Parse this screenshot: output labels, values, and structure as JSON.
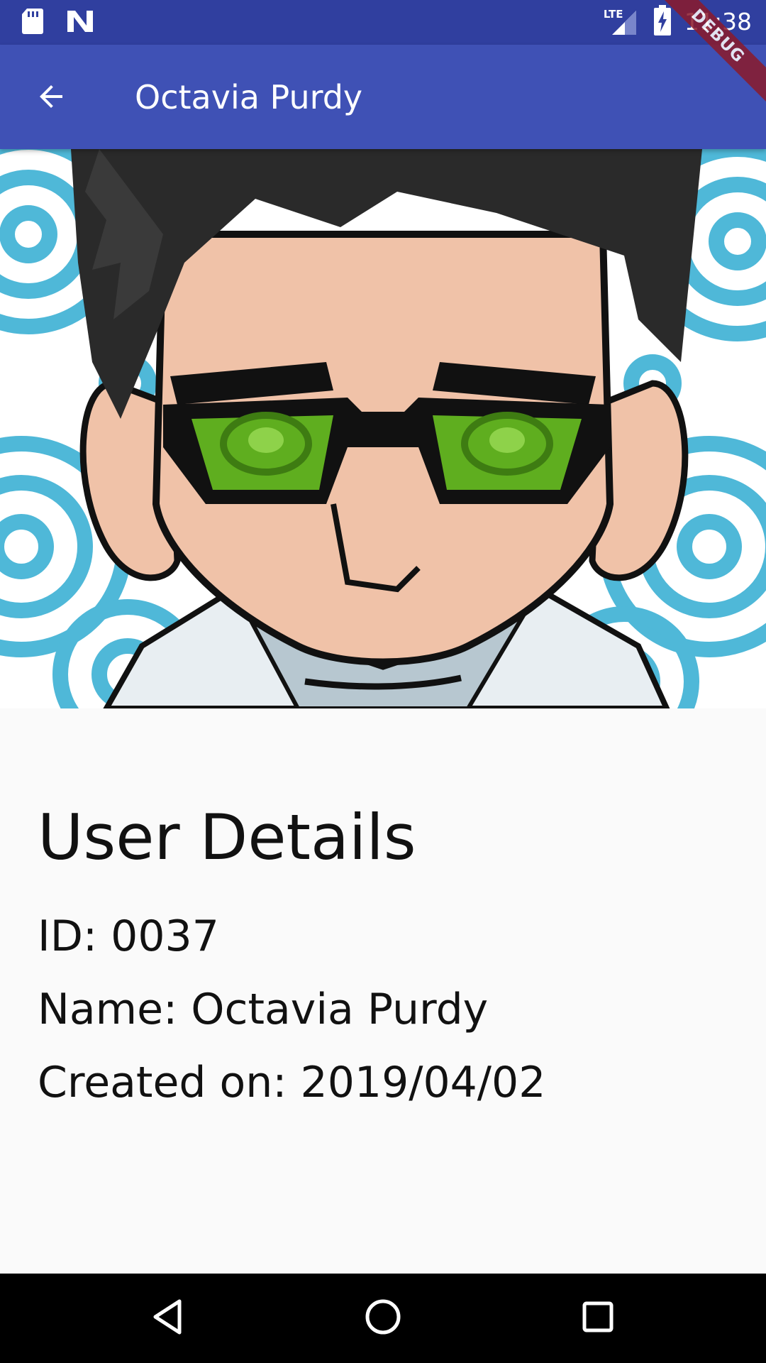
{
  "status_bar": {
    "time": "11:38",
    "network": "LTE",
    "icons": [
      "sd-card-icon",
      "n-notification-icon",
      "signal-icon",
      "battery-charging-icon"
    ]
  },
  "debug_banner": "DEBUG",
  "app_bar": {
    "title": "Octavia Purdy",
    "back_icon": "arrow-back-icon"
  },
  "details": {
    "heading": "User Details",
    "id_line": "ID: 0037",
    "name_line": "Name: Octavia Purdy",
    "created_line": "Created on: 2019/04/02"
  },
  "nav_bar": {
    "icons": [
      "back-triangle-icon",
      "home-circle-icon",
      "recents-square-icon"
    ]
  },
  "colors": {
    "status_bar": "#303f9f",
    "app_bar": "#3f51b5",
    "background": "#fafafa",
    "nav_bar": "#000000",
    "debug_ribbon": "#8b1a2b"
  }
}
